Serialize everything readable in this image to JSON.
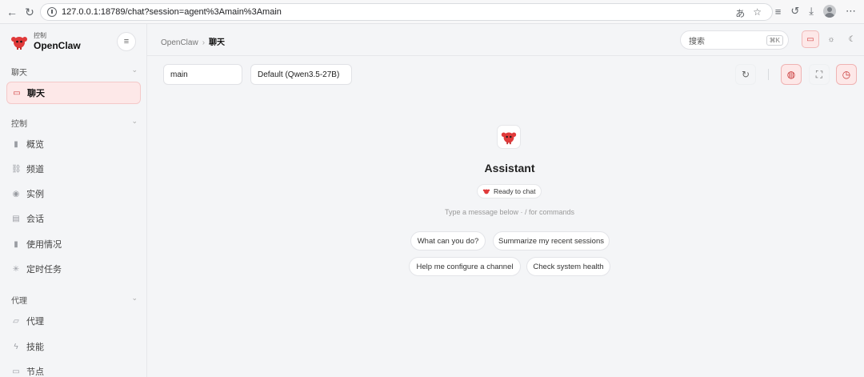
{
  "browser": {
    "url": "127.0.0.1:18789/chat?session=agent%3Amain%3Amain",
    "icons": [
      "back-arrow-icon",
      "reload-icon",
      "translate-icon",
      "star-icon",
      "reading-list-icon",
      "history-icon",
      "download-icon",
      "profile-avatar",
      "more-icon"
    ]
  },
  "brand": {
    "sub": "控制",
    "name": "OpenClaw"
  },
  "sidebar": {
    "sections": [
      {
        "title": "聊天",
        "items": [
          {
            "label": "聊天",
            "icon": "chat-icon",
            "active": true
          }
        ]
      },
      {
        "title": "控制",
        "items": [
          {
            "label": "概览",
            "icon": "bar-chart-icon"
          },
          {
            "label": "频道",
            "icon": "link-icon"
          },
          {
            "label": "实例",
            "icon": "broadcast-icon"
          },
          {
            "label": "会话",
            "icon": "document-icon"
          },
          {
            "label": "使用情况",
            "icon": "bar-chart-icon"
          },
          {
            "label": "定时任务",
            "icon": "loader-icon"
          }
        ]
      },
      {
        "title": "代理",
        "items": [
          {
            "label": "代理",
            "icon": "folder-icon"
          },
          {
            "label": "技能",
            "icon": "lightning-icon"
          },
          {
            "label": "节点",
            "icon": "monitor-icon"
          }
        ]
      }
    ]
  },
  "topbar": {
    "breadcrumb_root": "OpenClaw",
    "breadcrumb_current": "聊天",
    "search_placeholder": "搜索",
    "search_shortcut": "⌘K"
  },
  "toolbar": {
    "session_value": "main",
    "model_value": "Default (Qwen3.5-27B)"
  },
  "assistant": {
    "name": "Assistant",
    "status": "Ready to chat",
    "hint": "Type a message below · / for commands"
  },
  "suggestions": [
    "What can you do?",
    "Summarize my recent sessions",
    "Help me configure a channel",
    "Check system health"
  ],
  "colors": {
    "accent": "#d03b3b",
    "accent_bg": "#fde8e8",
    "background": "#f4f5f7"
  }
}
